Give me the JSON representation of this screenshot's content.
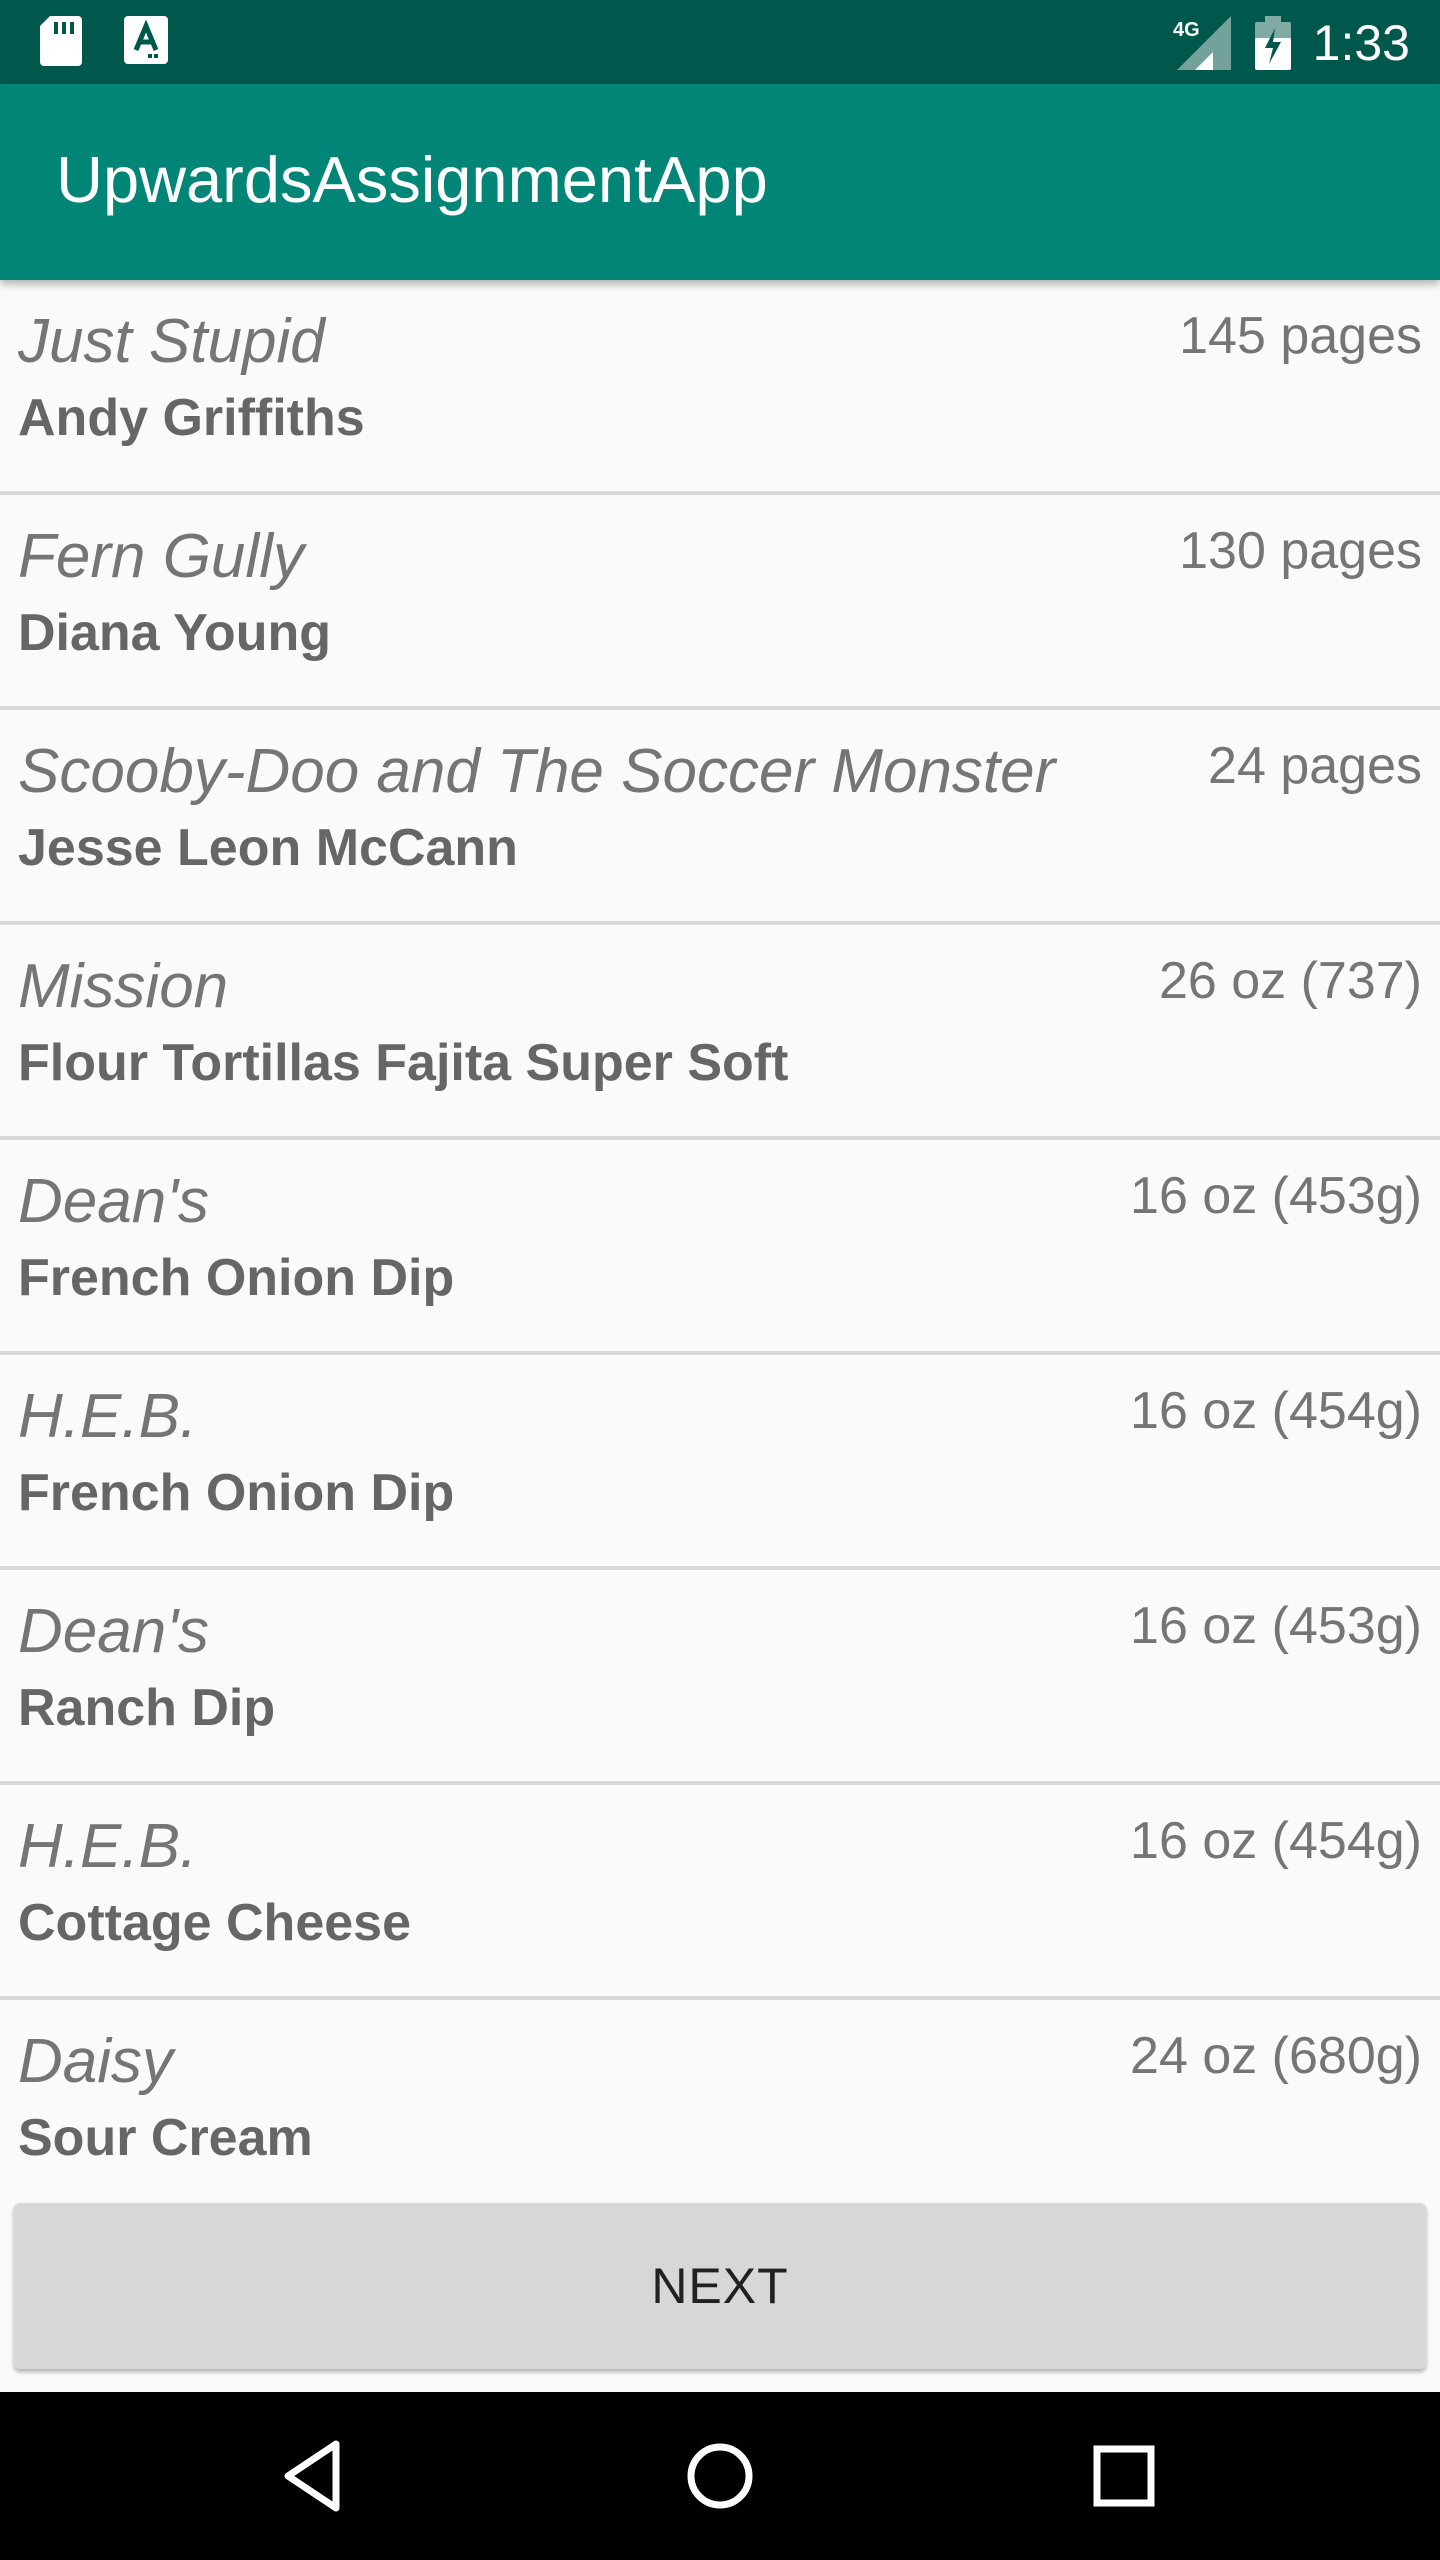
{
  "status_bar": {
    "time": "1:33",
    "network": "4G",
    "icons": [
      "sd-card-icon",
      "a-notification-icon",
      "signal-icon",
      "battery-icon"
    ]
  },
  "app_bar": {
    "title": "UpwardsAssignmentApp"
  },
  "list": {
    "items": [
      {
        "title": "Just Stupid",
        "subtitle": "Andy Griffiths",
        "size": "145 pages"
      },
      {
        "title": "Fern Gully",
        "subtitle": "Diana Young",
        "size": "130 pages"
      },
      {
        "title": "Scooby-Doo and The Soccer Monster",
        "subtitle": "Jesse Leon McCann",
        "size": "24 pages"
      },
      {
        "title": "Mission",
        "subtitle": "Flour Tortillas Fajita Super Soft",
        "size": "26 oz (737)"
      },
      {
        "title": "Dean's",
        "subtitle": "French Onion Dip",
        "size": "16 oz (453g)"
      },
      {
        "title": "H.E.B.",
        "subtitle": "French Onion Dip",
        "size": "16 oz (454g)"
      },
      {
        "title": "Dean's",
        "subtitle": "Ranch Dip",
        "size": "16 oz (453g)"
      },
      {
        "title": "H.E.B.",
        "subtitle": "Cottage Cheese",
        "size": "16 oz (454g)"
      },
      {
        "title": "Daisy",
        "subtitle": "Sour Cream",
        "size": "24 oz (680g)"
      }
    ]
  },
  "buttons": {
    "next_label": "NEXT"
  },
  "nav_bar": {
    "icons": [
      "back-icon",
      "home-icon",
      "recents-icon"
    ]
  },
  "colors": {
    "status_bar": "#00574b",
    "app_bar": "#008577",
    "background": "#fafafa",
    "button": "#d6d7d7"
  }
}
